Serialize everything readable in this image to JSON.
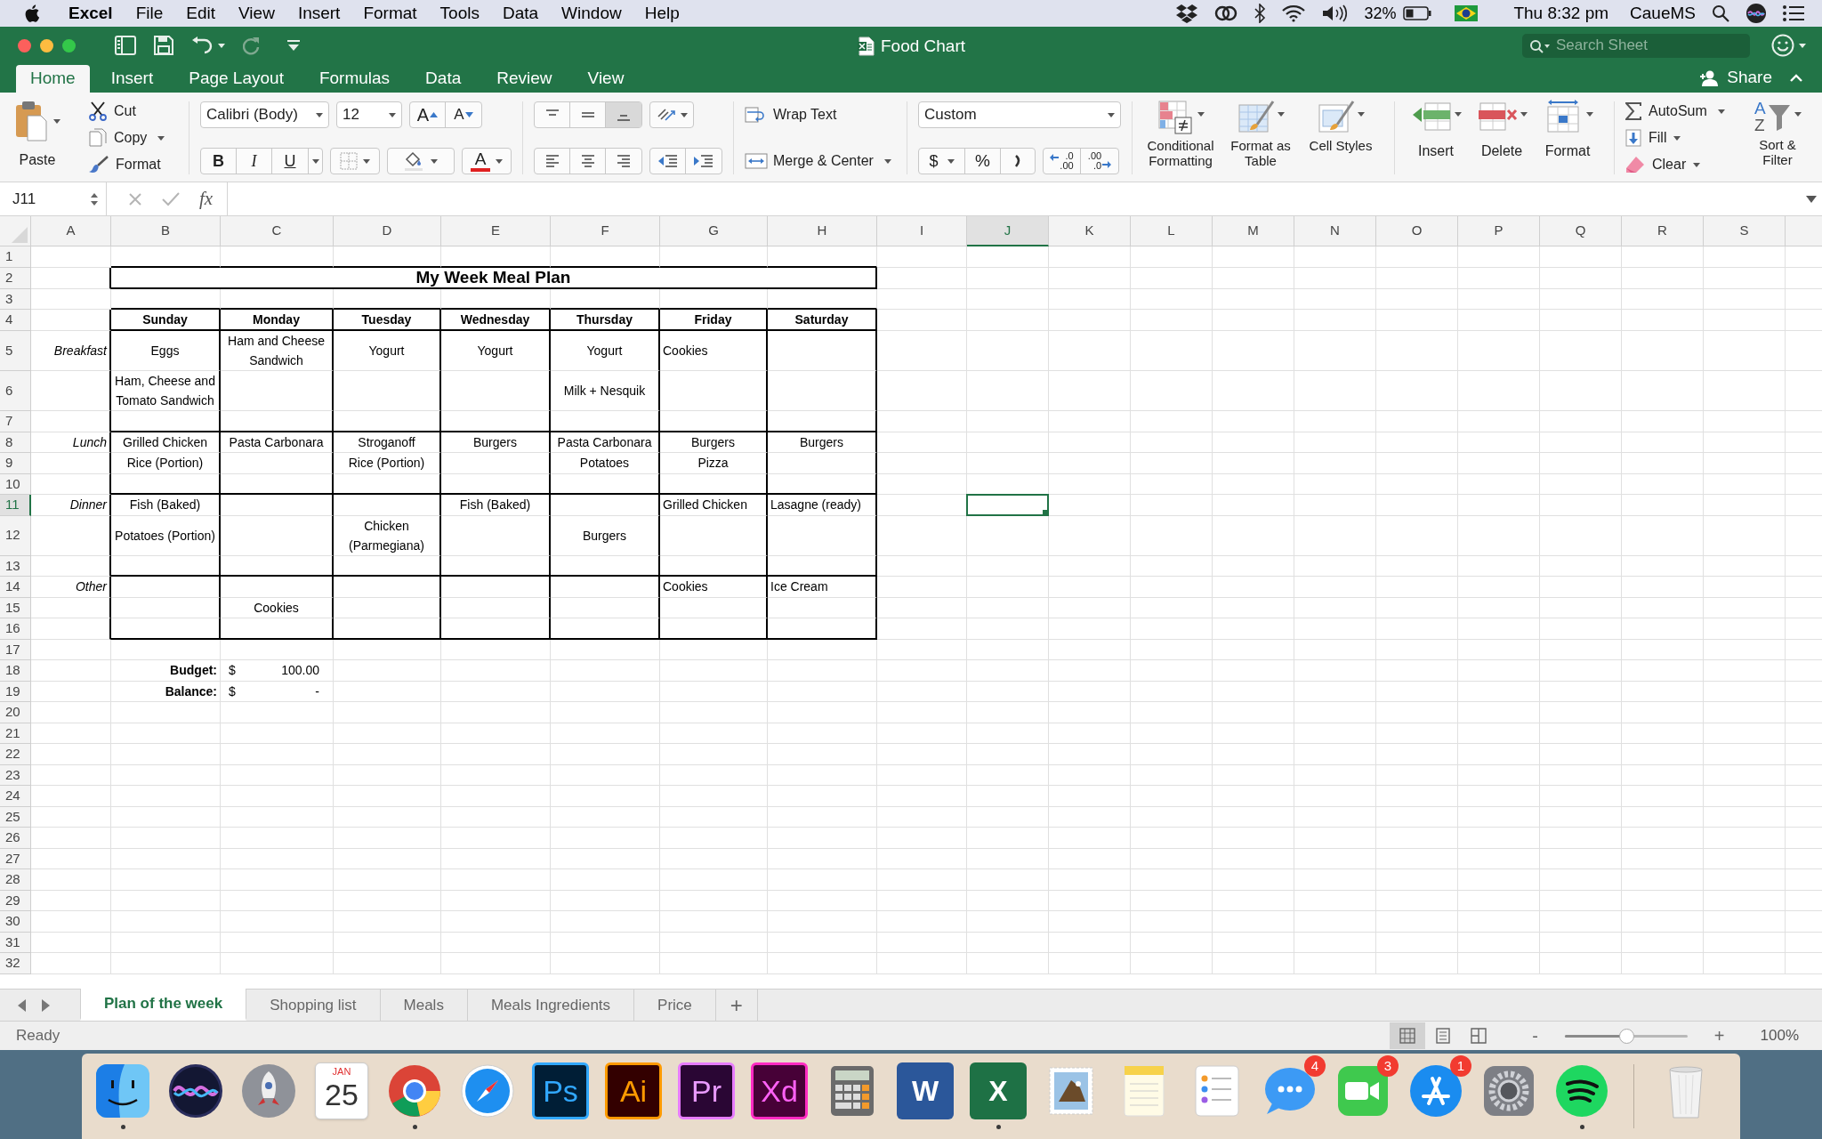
{
  "menu_bar": {
    "app": "Excel",
    "items": [
      "File",
      "Edit",
      "View",
      "Insert",
      "Format",
      "Tools",
      "Data",
      "Window",
      "Help"
    ],
    "battery": "32%",
    "clock": "Thu 8:32 pm",
    "user": "CaueMS"
  },
  "window": {
    "title": "Food Chart",
    "search": {
      "placeholder": "Search Sheet"
    }
  },
  "ribbon_tabs": [
    {
      "label": "Home",
      "selected": true
    },
    {
      "label": "Insert",
      "selected": false
    },
    {
      "label": "Page Layout",
      "selected": false
    },
    {
      "label": "Formulas",
      "selected": false
    },
    {
      "label": "Data",
      "selected": false
    },
    {
      "label": "Review",
      "selected": false
    },
    {
      "label": "View",
      "selected": false
    }
  ],
  "share": "Share",
  "ribbon": {
    "clipboard": {
      "paste": "Paste",
      "cut": "Cut",
      "copy": "Copy",
      "format": "Format"
    },
    "font": {
      "name": "Calibri (Body)",
      "size": "12",
      "grow": "A",
      "shrink": "A",
      "bold": "B",
      "italic": "I",
      "underline": "U",
      "font_color_button": "A"
    },
    "alignment": {
      "wrap": "Wrap Text",
      "merge": "Merge & Center"
    },
    "number": {
      "format": "Custom",
      "currency": "$",
      "percent": "%",
      "increase_decimal": [
        ".0",
        ".00"
      ],
      "decrease_decimal": [
        ".00",
        ".0"
      ]
    },
    "styles": [
      "Conditional Formatting",
      "Format as Table",
      "Cell Styles"
    ],
    "cells": [
      "Insert",
      "Delete",
      "Format"
    ],
    "editing": {
      "autosum": "AutoSum",
      "fill": "Fill",
      "clear": "Clear",
      "sort": "Sort & Filter",
      "sort_letters": [
        "A",
        "Z"
      ]
    }
  },
  "formula_bar": {
    "name_box": "J11",
    "function_label": "fx"
  },
  "sheet": {
    "columns": [
      {
        "label": "A",
        "selected": false
      },
      {
        "label": "B",
        "selected": false
      },
      {
        "label": "C",
        "selected": false
      },
      {
        "label": "D",
        "selected": false
      },
      {
        "label": "E",
        "selected": false
      },
      {
        "label": "F",
        "selected": false
      },
      {
        "label": "G",
        "selected": false
      },
      {
        "label": "H",
        "selected": false
      },
      {
        "label": "I",
        "selected": false
      },
      {
        "label": "J",
        "selected": true
      },
      {
        "label": "K",
        "selected": false
      },
      {
        "label": "L",
        "selected": false
      },
      {
        "label": "M",
        "selected": false
      },
      {
        "label": "N",
        "selected": false
      },
      {
        "label": "O",
        "selected": false
      },
      {
        "label": "P",
        "selected": false
      },
      {
        "label": "Q",
        "selected": false
      },
      {
        "label": "R",
        "selected": false
      },
      {
        "label": "S",
        "selected": false
      }
    ],
    "rows": [
      {
        "number": "1",
        "kind": "plain",
        "selected": false
      },
      {
        "number": "2",
        "kind": "title",
        "selected": false,
        "cells": {
          "B": {
            "text": "My Week Meal Plan",
            "kind": "title"
          }
        }
      },
      {
        "number": "3",
        "kind": "plain",
        "selected": false
      },
      {
        "number": "4",
        "kind": "header",
        "selected": false,
        "cells": {
          "B": {
            "text": "Sunday",
            "kind": "day"
          },
          "C": {
            "text": "Monday",
            "kind": "day"
          },
          "D": {
            "text": "Tuesday",
            "kind": "day"
          },
          "E": {
            "text": "Wednesday",
            "kind": "day"
          },
          "F": {
            "text": "Thursday",
            "kind": "day"
          },
          "G": {
            "text": "Friday",
            "kind": "day"
          },
          "H": {
            "text": "Saturday",
            "kind": "day"
          }
        }
      },
      {
        "number": "5",
        "kind": "group-top",
        "selected": false,
        "cells": {
          "A": {
            "text": "Breakfast",
            "kind": "label"
          },
          "B": "Eggs",
          "C": "Ham and Cheese Sandwich",
          "D": "Yogurt",
          "E": "Yogurt",
          "F": "Yogurt",
          "G": {
            "text": "Cookies",
            "kind": "left"
          }
        }
      },
      {
        "number": "6",
        "kind": "group-mid",
        "selected": false,
        "cells": {
          "B": "Ham, Cheese and Tomato Sandwich",
          "F": "Milk + Nesquik"
        }
      },
      {
        "number": "7",
        "kind": "group-bottom",
        "selected": false
      },
      {
        "number": "8",
        "kind": "group-top",
        "selected": false,
        "cells": {
          "A": {
            "text": "Lunch",
            "kind": "label"
          },
          "B": "Grilled Chicken",
          "C": "Pasta Carbonara",
          "D": "Stroganoff",
          "E": "Burgers",
          "F": "Pasta Carbonara",
          "G": "Burgers",
          "H": "Burgers"
        }
      },
      {
        "number": "9",
        "kind": "group-mid",
        "selected": false,
        "cells": {
          "B": "Rice (Portion)",
          "D": "Rice (Portion)",
          "F": "Potatoes",
          "G": "Pizza"
        }
      },
      {
        "number": "10",
        "kind": "group-bottom",
        "selected": false
      },
      {
        "number": "11",
        "kind": "group-top",
        "selected": true,
        "cells": {
          "A": {
            "text": "Dinner",
            "kind": "label"
          },
          "B": "Fish (Baked)",
          "E": "Fish (Baked)",
          "G": {
            "text": "Grilled Chicken",
            "kind": "left"
          },
          "H": {
            "text": "Lasagne (ready)",
            "kind": "left"
          }
        }
      },
      {
        "number": "12",
        "kind": "group-mid",
        "selected": false,
        "cells": {
          "B": "Potatoes (Portion)",
          "D": "Chicken (Parmegiana)",
          "F": "Burgers"
        }
      },
      {
        "number": "13",
        "kind": "group-bottom",
        "selected": false
      },
      {
        "number": "14",
        "kind": "group-top",
        "selected": false,
        "cells": {
          "A": {
            "text": "Other",
            "kind": "label"
          },
          "G": {
            "text": "Cookies",
            "kind": "left"
          },
          "H": {
            "text": "Ice Cream",
            "kind": "left"
          }
        }
      },
      {
        "number": "15",
        "kind": "group-mid",
        "selected": false,
        "cells": {
          "C": "Cookies"
        }
      },
      {
        "number": "16",
        "kind": "group-bottom",
        "selected": false
      },
      {
        "number": "17",
        "kind": "plain",
        "selected": false
      },
      {
        "number": "18",
        "kind": "plain",
        "selected": false,
        "cells": {
          "B": {
            "text": "Budget:",
            "kind": "caption"
          },
          "C": {
            "kind": "currency",
            "symbol": "$",
            "amount": "100.00"
          }
        }
      },
      {
        "number": "19",
        "kind": "plain",
        "selected": false,
        "cells": {
          "B": {
            "text": "Balance:",
            "kind": "caption"
          },
          "C": {
            "kind": "currency",
            "symbol": "$",
            "amount": "-"
          }
        }
      },
      {
        "number": "20",
        "kind": "plain",
        "selected": false
      },
      {
        "number": "21",
        "kind": "plain",
        "selected": false
      },
      {
        "number": "22",
        "kind": "plain",
        "selected": false
      },
      {
        "number": "23",
        "kind": "plain",
        "selected": false
      },
      {
        "number": "24",
        "kind": "plain",
        "selected": false
      },
      {
        "number": "25",
        "kind": "plain",
        "selected": false
      },
      {
        "number": "26",
        "kind": "plain",
        "selected": false
      },
      {
        "number": "27",
        "kind": "plain",
        "selected": false
      },
      {
        "number": "28",
        "kind": "plain",
        "selected": false
      },
      {
        "number": "29",
        "kind": "plain",
        "selected": false
      },
      {
        "number": "30",
        "kind": "plain",
        "selected": false
      },
      {
        "number": "31",
        "kind": "plain",
        "selected": false
      },
      {
        "number": "32",
        "kind": "plain",
        "selected": false
      }
    ]
  },
  "sheet_tabs": [
    {
      "label": "Plan of the week",
      "selected": true
    },
    {
      "label": "Shopping list",
      "selected": false
    },
    {
      "label": "Meals",
      "selected": false
    },
    {
      "label": "Meals Ingredients",
      "selected": false
    },
    {
      "label": "Price",
      "selected": false
    }
  ],
  "add_sheet": "+",
  "status_bar": {
    "text": "Ready",
    "views": [
      {
        "kind": "normal",
        "selected": true
      },
      {
        "kind": "page-layout",
        "selected": false
      },
      {
        "kind": "page-break",
        "selected": false
      }
    ],
    "zoom_out": "-",
    "zoom_in": "+",
    "zoom": "100%",
    "zoom_slider": {
      "level": 0.5
    }
  },
  "dock": [
    {
      "kind": "finder",
      "running": true
    },
    {
      "kind": "siri",
      "running": false
    },
    {
      "kind": "launchpad",
      "running": false
    },
    {
      "kind": "calendar",
      "running": false,
      "month": "JAN",
      "day": "25"
    },
    {
      "kind": "chrome",
      "running": true
    },
    {
      "kind": "safari",
      "running": false
    },
    {
      "kind": "ps",
      "running": false,
      "label": "Ps"
    },
    {
      "kind": "ai",
      "running": false,
      "label": "Ai"
    },
    {
      "kind": "pr",
      "running": false,
      "label": "Pr"
    },
    {
      "kind": "xd",
      "running": false,
      "label": "Xd"
    },
    {
      "kind": "calculator",
      "running": false
    },
    {
      "kind": "word",
      "running": false,
      "label": "W"
    },
    {
      "kind": "excel",
      "running": true,
      "label": "X"
    },
    {
      "kind": "mail",
      "running": false
    },
    {
      "kind": "notes",
      "running": false
    },
    {
      "kind": "reminders",
      "running": false
    },
    {
      "kind": "messages",
      "running": false,
      "badge": "4"
    },
    {
      "kind": "facetime",
      "running": false,
      "badge": "3"
    },
    {
      "kind": "appstore",
      "running": false,
      "badge": "1"
    },
    {
      "kind": "settings",
      "running": false
    },
    {
      "kind": "spotify",
      "running": true
    },
    {
      "kind": "trash",
      "running": false
    }
  ]
}
